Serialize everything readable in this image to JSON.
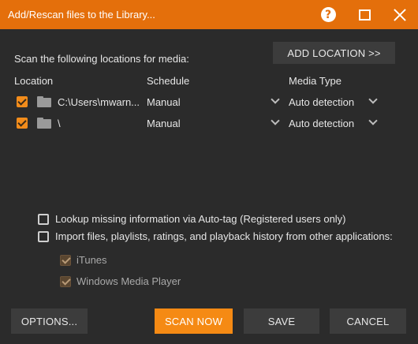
{
  "window": {
    "title": "Add/Rescan files to the Library..."
  },
  "scan_label": "Scan the following locations for media:",
  "add_location_label": "ADD LOCATION >>",
  "columns": {
    "location": "Location",
    "schedule": "Schedule",
    "media_type": "Media Type"
  },
  "locations": [
    {
      "checked": true,
      "path": "C:\\Users\\mwarn...",
      "schedule": "Manual",
      "media_type": "Auto detection"
    },
    {
      "checked": true,
      "path": "\\",
      "schedule": "Manual",
      "media_type": "Auto detection"
    }
  ],
  "options": {
    "autotag": {
      "checked": false,
      "label": "Lookup missing information via Auto-tag (Registered users only)"
    },
    "import": {
      "checked": false,
      "label": "Import files, playlists, ratings, and playback history from other applications:"
    },
    "itunes": {
      "checked": true,
      "enabled": false,
      "label": "iTunes"
    },
    "wmp": {
      "checked": true,
      "enabled": false,
      "label": "Windows Media Player"
    }
  },
  "buttons": {
    "options": "OPTIONS...",
    "scan_now": "SCAN NOW",
    "save": "SAVE",
    "cancel": "CANCEL"
  },
  "colors": {
    "title_bar": "#e46f0b",
    "accent": "#f58a14",
    "background": "#2b2b2b",
    "button": "#3c3c3c"
  },
  "icons": [
    "help-icon",
    "maximize-icon",
    "close-icon",
    "folder-icon",
    "chevron-down-icon",
    "checkbox-icon"
  ]
}
